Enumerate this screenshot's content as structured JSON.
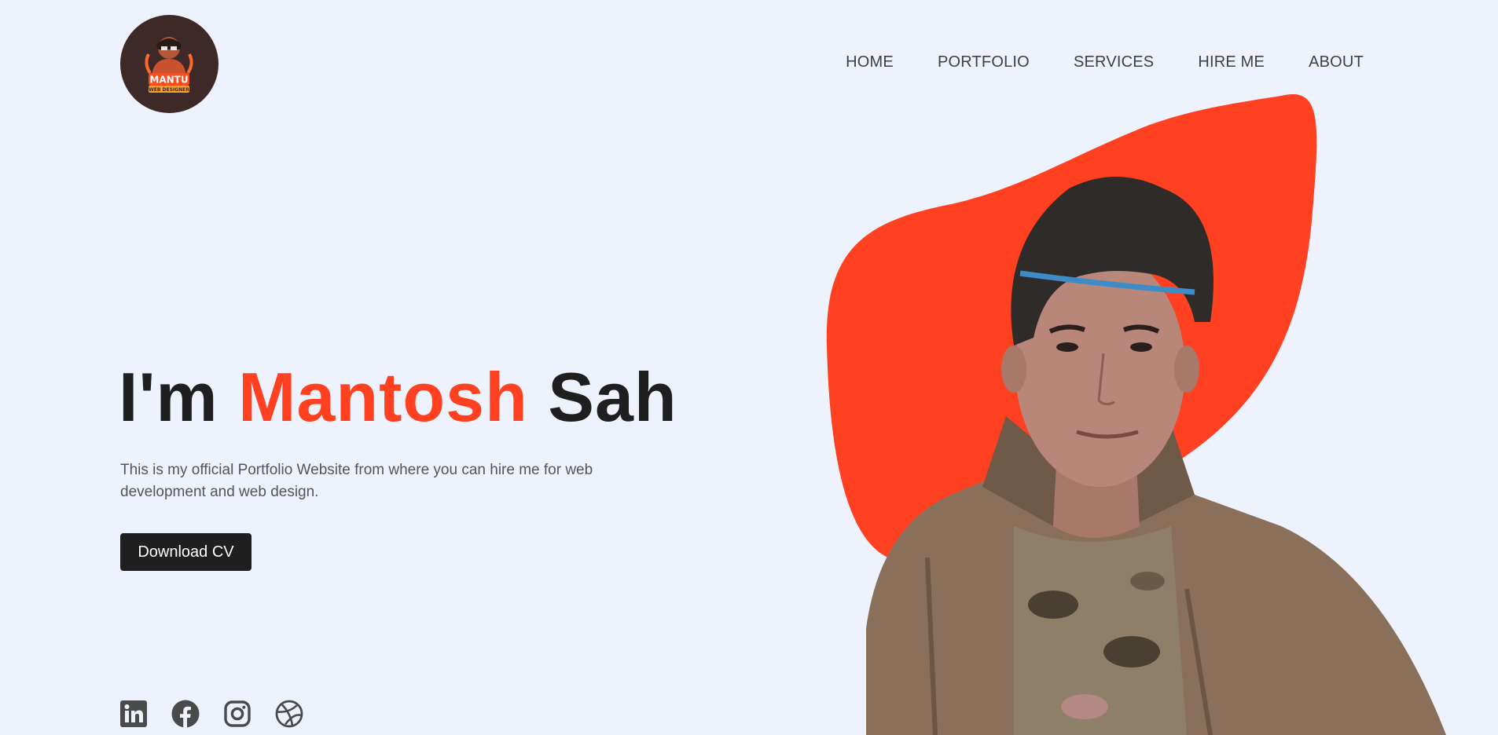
{
  "logo": {
    "icon": "mantu-web-designer-logo",
    "line1": "MANTU",
    "line2": "WEB DESIGNER"
  },
  "nav": {
    "items": [
      {
        "label": "HOME"
      },
      {
        "label": "PORTFOLIO"
      },
      {
        "label": "SERVICES"
      },
      {
        "label": "HIRE ME"
      },
      {
        "label": "ABOUT"
      }
    ]
  },
  "hero": {
    "title_prefix": "I'm",
    "title_name": "Mantosh",
    "title_suffix": "Sah",
    "description": "This is my official Portfolio Website from where you can hire me for web development and web design.",
    "cta_label": "Download CV"
  },
  "socials": [
    {
      "icon": "linkedin-icon"
    },
    {
      "icon": "facebook-icon"
    },
    {
      "icon": "instagram-icon"
    },
    {
      "icon": "dribbble-icon"
    }
  ],
  "colors": {
    "background": "#eef2fd",
    "accent": "#ff4122",
    "text_dark": "#1f1f1f",
    "text_muted": "#555555",
    "nav_text": "#3f3f3f",
    "logo_bg": "#3d2a28",
    "icon_color": "#4a4a4a"
  }
}
